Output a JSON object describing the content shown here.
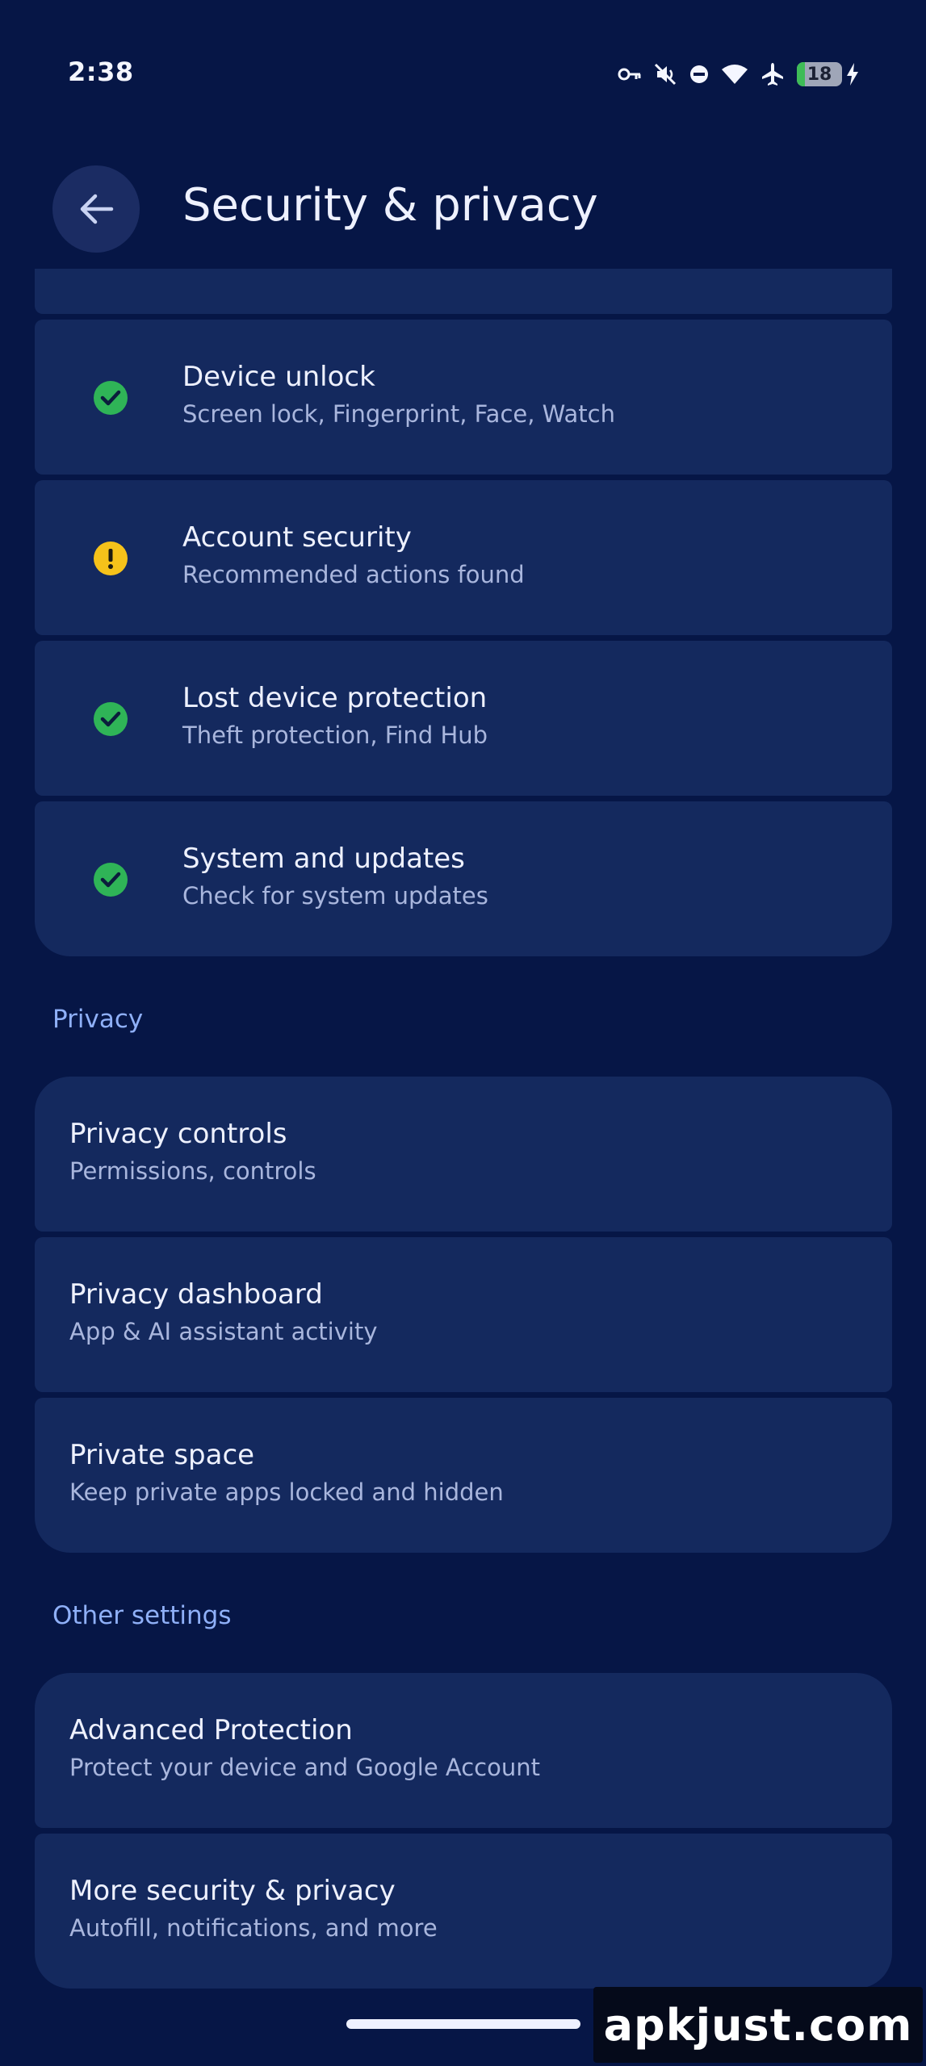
{
  "status_bar": {
    "time": "2:38",
    "battery_level": "18",
    "icons": [
      "vpn-key-icon",
      "muted-icon",
      "dnd-icon",
      "wifi-icon",
      "airplane-icon",
      "battery-icon",
      "charging-icon"
    ]
  },
  "header": {
    "title": "Security & privacy",
    "back_icon": "arrow-back-icon"
  },
  "security_items": [
    {
      "title": "Device unlock",
      "subtitle": "Screen lock, Fingerprint, Face, Watch",
      "status": "ok"
    },
    {
      "title": "Account security",
      "subtitle": "Recommended actions found",
      "status": "warning"
    },
    {
      "title": "Lost device protection",
      "subtitle": "Theft protection, Find Hub",
      "status": "ok"
    },
    {
      "title": "System and updates",
      "subtitle": "Check for system updates",
      "status": "ok"
    }
  ],
  "privacy": {
    "header": "Privacy",
    "items": [
      {
        "title": "Privacy controls",
        "subtitle": "Permissions, controls"
      },
      {
        "title": "Privacy dashboard",
        "subtitle": "App & AI assistant activity"
      },
      {
        "title": "Private space",
        "subtitle": "Keep private apps locked and hidden"
      }
    ]
  },
  "other": {
    "header": "Other settings",
    "items": [
      {
        "title": "Advanced Protection",
        "subtitle": "Protect your device and Google Account"
      },
      {
        "title": "More security & privacy",
        "subtitle": "Autofill, notifications, and more"
      }
    ]
  },
  "watermark": "apkjust.com",
  "colors": {
    "background": "#061646",
    "card": "#14295e",
    "ok_green": "#2fb457",
    "warning_yellow": "#f6c21a",
    "section_header": "#8fb0f8"
  }
}
